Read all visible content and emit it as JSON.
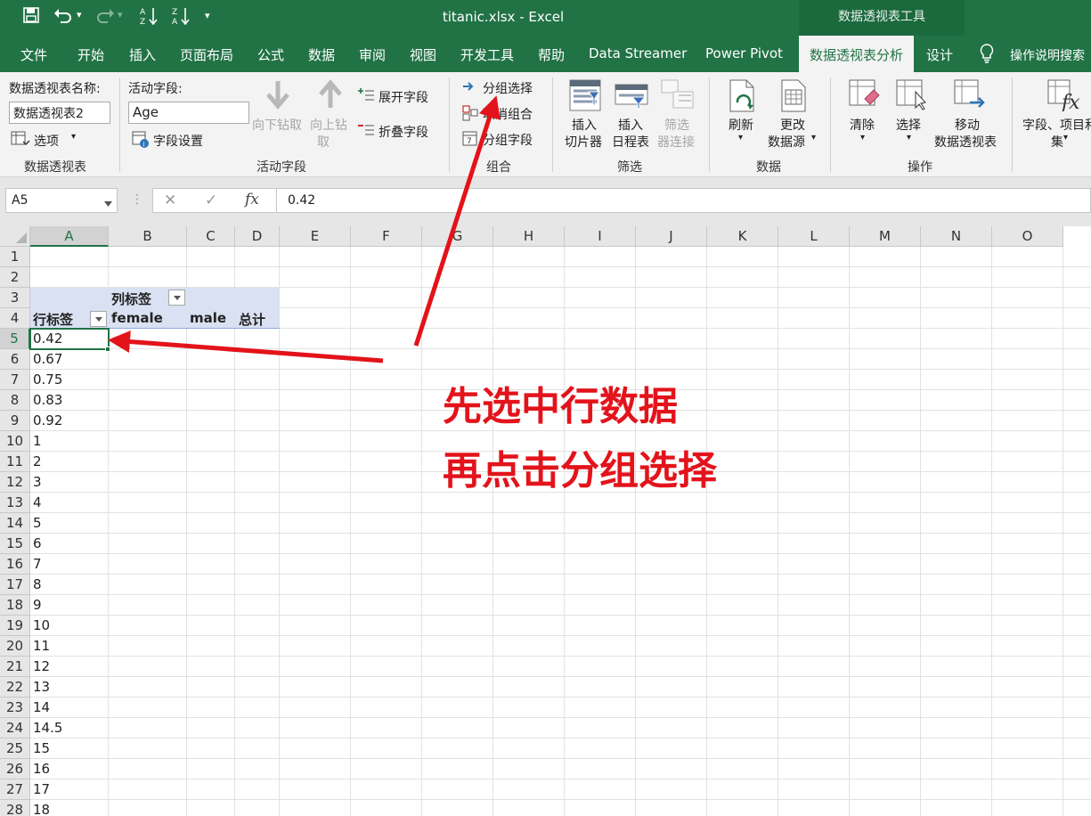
{
  "quick_access": {
    "save_icon": "save-icon",
    "undo_icon": "undo-icon",
    "redo_icon": "redo-icon",
    "sort_asc_icon": "sort-asc-icon",
    "sort_desc_icon": "sort-desc-icon",
    "more": "▾"
  },
  "window": {
    "title": "titanic.xlsx  -  Excel",
    "context_tool": "数据透视表工具"
  },
  "tabs": [
    "文件",
    "开始",
    "插入",
    "页面布局",
    "公式",
    "数据",
    "审阅",
    "视图",
    "开发工具",
    "帮助",
    "Data Streamer",
    "Power Pivot",
    "数据透视表分析",
    "设计"
  ],
  "active_tab": "数据透视表分析",
  "tell_me": "操作说明搜索",
  "ribbon": {
    "pivot_name_label": "数据透视表名称:",
    "pivot_name_value": "数据透视表2",
    "options_label": "选项",
    "group_pivot": "数据透视表",
    "active_field_label": "活动字段:",
    "active_field_value": "Age",
    "field_settings": "字段设置",
    "drill_down": "向下钻取",
    "drill_up_1": "向上钻",
    "drill_up_2": "取",
    "expand_field": "展开字段",
    "collapse_field": "折叠字段",
    "group_active_field": "活动字段",
    "group_selection": "分组选择",
    "ungroup": "取消组合",
    "group_field": "分组字段",
    "group_group": "组合",
    "insert_slicer_1": "插入",
    "insert_slicer_2": "切片器",
    "insert_timeline_1": "插入",
    "insert_timeline_2": "日程表",
    "filter_conn_1": "筛选",
    "filter_conn_2": "器连接",
    "group_filter": "筛选",
    "refresh": "刷新",
    "change_source_1": "更改",
    "change_source_2": "数据源",
    "group_data": "数据",
    "clear": "清除",
    "select": "选择",
    "move_pivot_1": "移动",
    "move_pivot_2": "数据透视表",
    "group_actions": "操作",
    "fields_items_1": "字段、项目和",
    "fields_items_2": "集"
  },
  "formula_bar": {
    "name_box": "A5",
    "cancel": "✕",
    "enter": "✓",
    "fx": "fx",
    "value": "0.42"
  },
  "columns": [
    "A",
    "B",
    "C",
    "D",
    "E",
    "F",
    "G",
    "H",
    "I",
    "J",
    "K",
    "L",
    "M",
    "N",
    "O"
  ],
  "rows": [
    "1",
    "2",
    "3",
    "4",
    "5",
    "6",
    "7",
    "8",
    "9",
    "10",
    "11",
    "12",
    "13",
    "14",
    "15",
    "16",
    "17",
    "18",
    "19",
    "20",
    "21",
    "22",
    "23",
    "24",
    "25",
    "26",
    "27",
    "28"
  ],
  "pivot": {
    "col_labels": "列标签",
    "row_labels": "行标签",
    "female": "female",
    "male": "male",
    "total": "总计",
    "ages": [
      "0.42",
      "0.67",
      "0.75",
      "0.83",
      "0.92",
      "1",
      "2",
      "3",
      "4",
      "5",
      "6",
      "7",
      "8",
      "9",
      "10",
      "11",
      "12",
      "13",
      "14",
      "14.5",
      "15",
      "16",
      "17",
      "18"
    ]
  },
  "annotation": {
    "line1": "先选中行数据",
    "line2": "再点击分组选择",
    "color": "#e3131b"
  },
  "colors": {
    "excel_green": "#217346",
    "pivot_header": "#d9e1f2"
  }
}
